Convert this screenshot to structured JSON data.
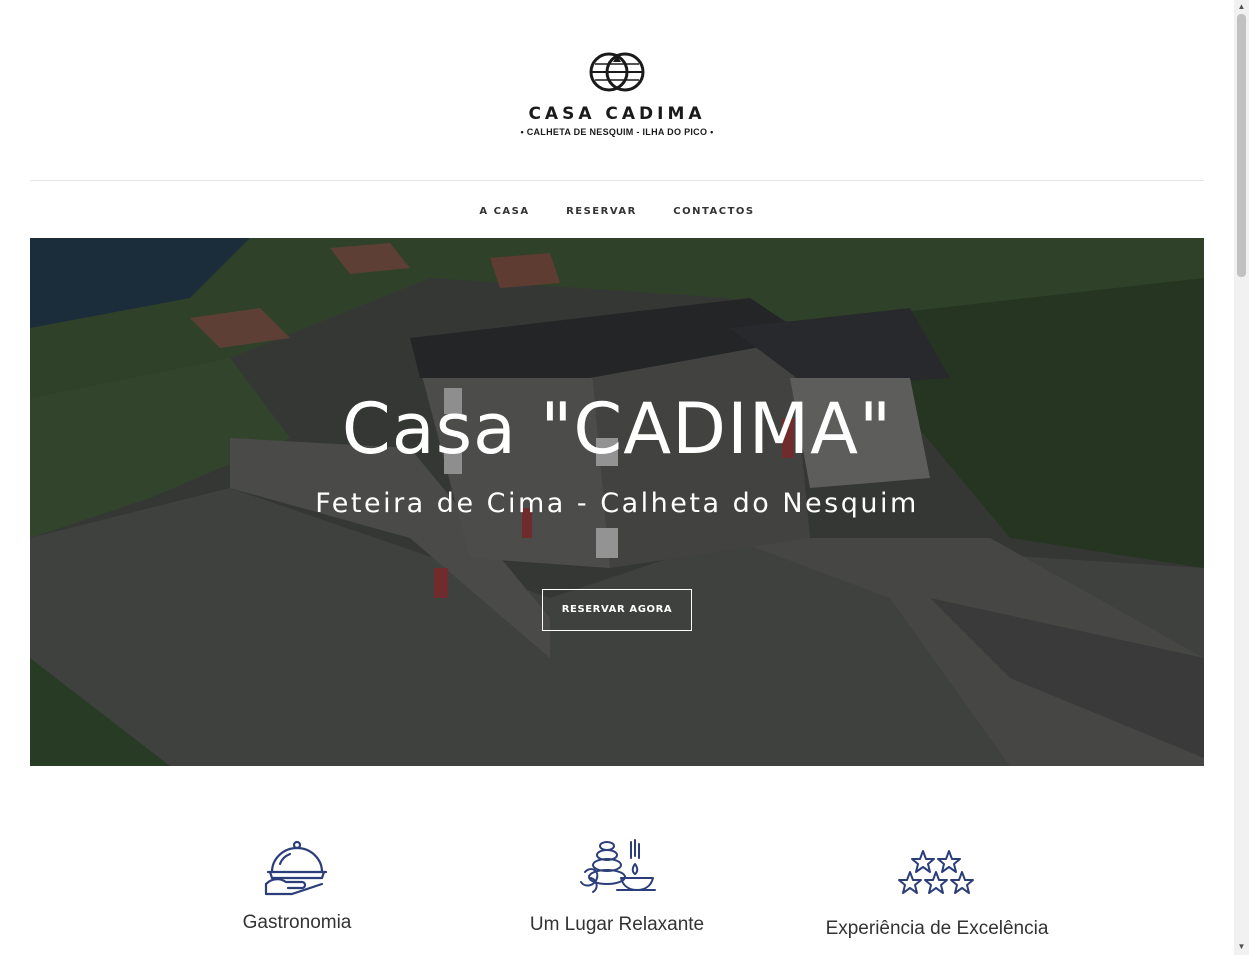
{
  "header": {
    "brand_name": "CASA CADIMA",
    "tagline": "• CALHETA DE NESQUIM - ILHA DO PICO •",
    "logo_icon": "casa-cadima-emblem"
  },
  "nav": {
    "items": [
      {
        "label": "A CASA"
      },
      {
        "label": "RESERVAR"
      },
      {
        "label": "CONTACTOS"
      }
    ]
  },
  "hero": {
    "title": "Casa \"CADIMA\"",
    "subtitle": "Feteira de Cima - Calheta do Nesquim",
    "cta_label": "RESERVAR AGORA"
  },
  "features": [
    {
      "icon": "cloche-serving-icon",
      "title": "Gastronomia"
    },
    {
      "icon": "spa-stones-candle-icon",
      "title": "Um Lugar Relaxante"
    },
    {
      "icon": "stars-rating-icon",
      "title": "Experiência de Excelência"
    }
  ],
  "colors": {
    "icon_blue": "#2c3e7a",
    "divider": "#e6e6e6",
    "text_dark": "#1a1a1a"
  }
}
